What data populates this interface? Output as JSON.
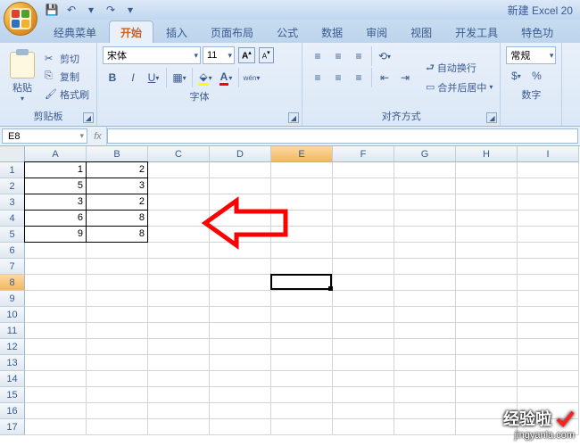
{
  "title": "新建 Excel 20",
  "qat": {
    "save": "💾",
    "undo": "↶",
    "redo": "↷",
    "more": "▾"
  },
  "tabs": [
    "经典菜单",
    "开始",
    "插入",
    "页面布局",
    "公式",
    "数据",
    "审阅",
    "视图",
    "开发工具",
    "特色功"
  ],
  "active_tab": 1,
  "clipboard": {
    "label": "剪贴板",
    "paste": "粘贴",
    "cut": "剪切",
    "copy": "复制",
    "format_painter": "格式刷"
  },
  "font": {
    "label": "字体",
    "name": "宋体",
    "size": "11",
    "grow": "A",
    "shrink": "A",
    "bold": "B",
    "italic": "I",
    "underline": "U"
  },
  "alignment": {
    "label": "对齐方式",
    "wrap": "自动换行",
    "merge": "合并后居中"
  },
  "number": {
    "label": "数字",
    "format": "常规"
  },
  "name_box": "E8",
  "columns": [
    "A",
    "B",
    "C",
    "D",
    "E",
    "F",
    "G",
    "H",
    "I"
  ],
  "rows": [
    1,
    2,
    3,
    4,
    5,
    6,
    7,
    8,
    9,
    10,
    11,
    12,
    13,
    14,
    15,
    16,
    17
  ],
  "active_col": 4,
  "active_row": 7,
  "data": {
    "A1": "1",
    "B1": "2",
    "A2": "5",
    "B2": "3",
    "A3": "3",
    "B3": "2",
    "A4": "6",
    "B4": "8",
    "A5": "9",
    "B5": "8"
  },
  "bordered_range": {
    "r1": 0,
    "c1": 0,
    "r2": 4,
    "c2": 1
  },
  "watermark": {
    "text": "经验啦",
    "url": "jingyanla.com"
  }
}
